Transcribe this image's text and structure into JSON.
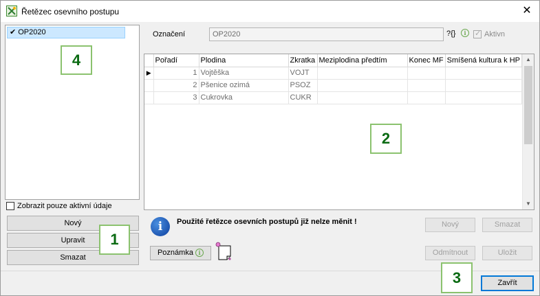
{
  "window": {
    "title": "Řetězec osevního postupu",
    "close_label": "✕"
  },
  "left_panel": {
    "items": [
      {
        "label": "OP2020",
        "checked_mark": "✔"
      }
    ],
    "show_active_only_label": "Zobrazit pouze aktivní údaje",
    "buttons": {
      "new": "Nový",
      "edit": "Upravit",
      "delete": "Smazat"
    }
  },
  "form": {
    "designation_label": "Označení",
    "designation_value": "OP2020",
    "help_glyph": "?{}",
    "active_label": "Aktivn"
  },
  "grid": {
    "columns": [
      "Pořadí",
      "Plodina",
      "Zkratka",
      "Meziplodina předtím",
      "Konec MF",
      "Smíšená kultura k HP"
    ],
    "rows": [
      {
        "order": "1",
        "crop": "Vojtěška",
        "abbr": "VOJT",
        "catch_crop": "",
        "end_mf": "",
        "mixed": ""
      },
      {
        "order": "2",
        "crop": "Pšenice ozimá",
        "abbr": "PSOZ",
        "catch_crop": "",
        "end_mf": "",
        "mixed": ""
      },
      {
        "order": "3",
        "crop": "Cukrovka",
        "abbr": "CUKR",
        "catch_crop": "",
        "end_mf": "",
        "mixed": ""
      }
    ],
    "current_row_marker": "▶"
  },
  "info_message": "Použité řetězce osevních postupů již nelze měnit !",
  "right_buttons": {
    "new": "Nový",
    "delete": "Smazat",
    "reject": "Odmítnout",
    "save": "Uložit"
  },
  "note_button": "Poznámka",
  "close_button": "Zavřít",
  "callouts": {
    "c1": "1",
    "c2": "2",
    "c3": "3",
    "c4": "4"
  }
}
